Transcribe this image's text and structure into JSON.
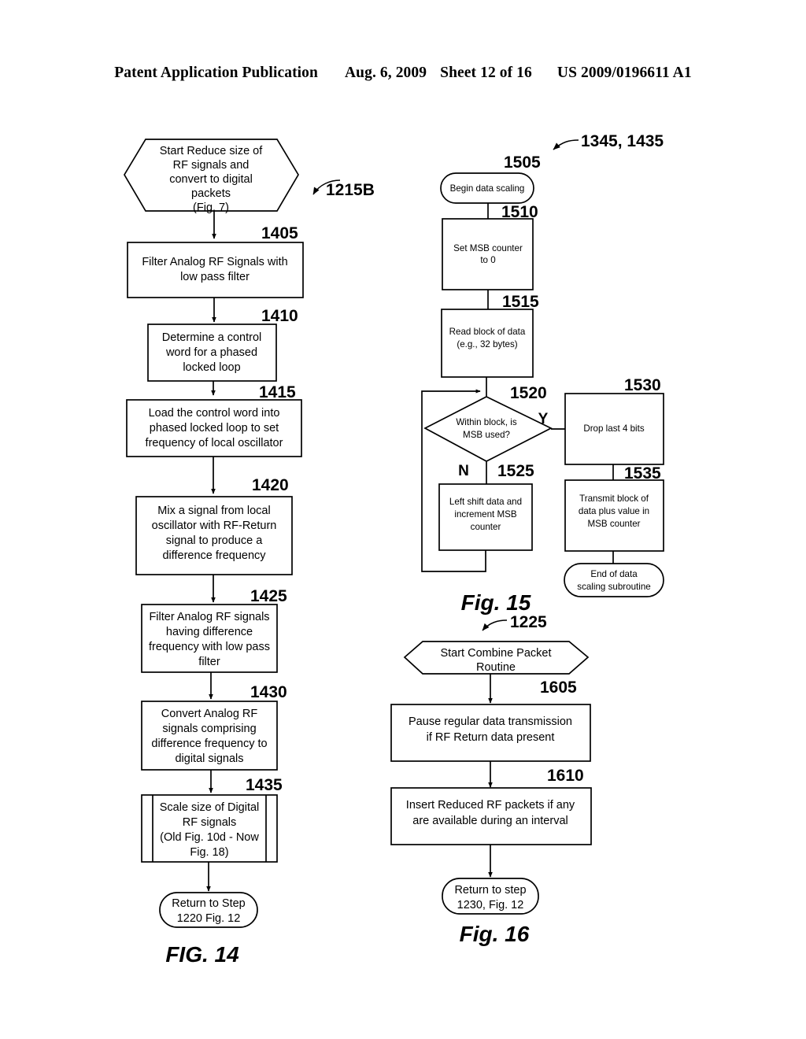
{
  "header": {
    "publication": "Patent Application Publication",
    "date": "Aug. 6, 2009",
    "sheet": "Sheet 12 of 16",
    "doc_number": "US 2009/0196611 A1"
  },
  "figures": [
    {
      "id": "fig14",
      "label": "FIG. 14",
      "callout": "1215B",
      "nodes": [
        {
          "ref": "",
          "shape": "hexagon",
          "lines": [
            "Start Reduce size of",
            "RF signals and",
            "convert to digital",
            "packets",
            "(Fig. 7)"
          ]
        },
        {
          "ref": "1405",
          "shape": "process",
          "lines": [
            "Filter Analog RF Signals with",
            "low pass filter"
          ]
        },
        {
          "ref": "1410",
          "shape": "process",
          "lines": [
            "Determine a control",
            "word for a phased",
            "locked loop"
          ]
        },
        {
          "ref": "1415",
          "shape": "process",
          "lines": [
            "Load the control word into",
            "phased locked loop to set",
            "frequency of local oscillator"
          ]
        },
        {
          "ref": "1420",
          "shape": "process",
          "lines": [
            "Mix a signal from local",
            "oscillator with RF-Return",
            "signal to produce a",
            "difference frequency"
          ]
        },
        {
          "ref": "1425",
          "shape": "process",
          "lines": [
            "Filter Analog RF signals",
            "having difference",
            "frequency with low pass",
            "filter"
          ]
        },
        {
          "ref": "1430",
          "shape": "process",
          "lines": [
            "Convert Analog RF",
            "signals comprising",
            "difference frequency to",
            "digital signals"
          ]
        },
        {
          "ref": "1435",
          "shape": "subroutine",
          "lines": [
            "Scale size of Digital",
            "RF signals",
            "(Old Fig. 10d - Now",
            "Fig. 18)"
          ]
        },
        {
          "ref": "",
          "shape": "terminator",
          "lines": [
            "Return to Step",
            "1220 Fig. 12"
          ]
        }
      ]
    },
    {
      "id": "fig15",
      "label": "Fig. 15",
      "callout": "1345, 1435",
      "branch_yes": "Y",
      "branch_no": "N",
      "nodes": [
        {
          "ref": "1505",
          "shape": "terminator",
          "lines": [
            "Begin data scaling"
          ]
        },
        {
          "ref": "1510",
          "shape": "process",
          "lines": [
            "Set MSB counter",
            "to 0"
          ]
        },
        {
          "ref": "1515",
          "shape": "process",
          "lines": [
            "Read block of data",
            "(e.g., 32 bytes)"
          ]
        },
        {
          "ref": "1520",
          "shape": "decision",
          "lines": [
            "Within block, is",
            "MSB used?"
          ]
        },
        {
          "ref": "1525",
          "shape": "process",
          "lines": [
            "Left shift data and",
            "increment MSB",
            "counter"
          ]
        },
        {
          "ref": "1530",
          "shape": "process",
          "lines": [
            "Drop last 4 bits"
          ]
        },
        {
          "ref": "1535",
          "shape": "process",
          "lines": [
            "Transmit block of",
            "data plus value in",
            "MSB counter"
          ]
        },
        {
          "ref": "",
          "shape": "terminator",
          "lines": [
            "End of data",
            "scaling subroutine"
          ]
        }
      ]
    },
    {
      "id": "fig16",
      "label": "Fig. 16",
      "callout": "1225",
      "nodes": [
        {
          "ref": "",
          "shape": "hexagon",
          "lines": [
            "Start Combine Packet",
            "Routine"
          ]
        },
        {
          "ref": "1605",
          "shape": "process",
          "lines": [
            "Pause regular data transmission",
            "if RF Return data present"
          ]
        },
        {
          "ref": "1610",
          "shape": "process",
          "lines": [
            "Insert Reduced RF packets if any",
            "are available during an interval"
          ]
        },
        {
          "ref": "",
          "shape": "terminator",
          "lines": [
            "Return to step",
            "1230, Fig. 12"
          ]
        }
      ]
    }
  ]
}
